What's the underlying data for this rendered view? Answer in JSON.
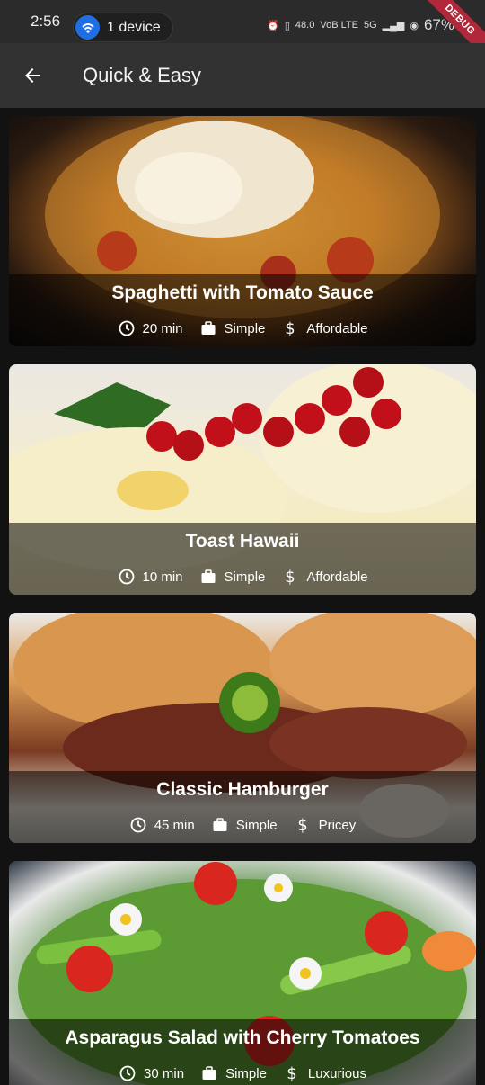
{
  "status_bar": {
    "time": "2:56",
    "device_label": "1 device",
    "network_speed": "48.0",
    "network_unit": "KB/S",
    "sim_label": "VoB LTE",
    "five_g": "5G",
    "battery": "67%",
    "debug_label": "DEBUG"
  },
  "app_bar": {
    "title": "Quick & Easy"
  },
  "meals": [
    {
      "title": "Spaghetti with Tomato Sauce",
      "duration": "20 min",
      "complexity": "Simple",
      "affordability": "Affordable"
    },
    {
      "title": "Toast Hawaii",
      "duration": "10 min",
      "complexity": "Simple",
      "affordability": "Affordable"
    },
    {
      "title": "Classic Hamburger",
      "duration": "45 min",
      "complexity": "Simple",
      "affordability": "Pricey"
    },
    {
      "title": "Asparagus Salad with Cherry Tomatoes",
      "duration": "30 min",
      "complexity": "Simple",
      "affordability": "Luxurious"
    }
  ],
  "icons": {
    "back": "arrow-back-icon",
    "duration": "schedule-icon",
    "complexity": "work-icon",
    "affordability": "attach-money-icon"
  },
  "colors": {
    "app_bar": "#333232",
    "background": "#121212",
    "debug_banner": "#b0283a",
    "device_dot": "#1e6fe6"
  }
}
